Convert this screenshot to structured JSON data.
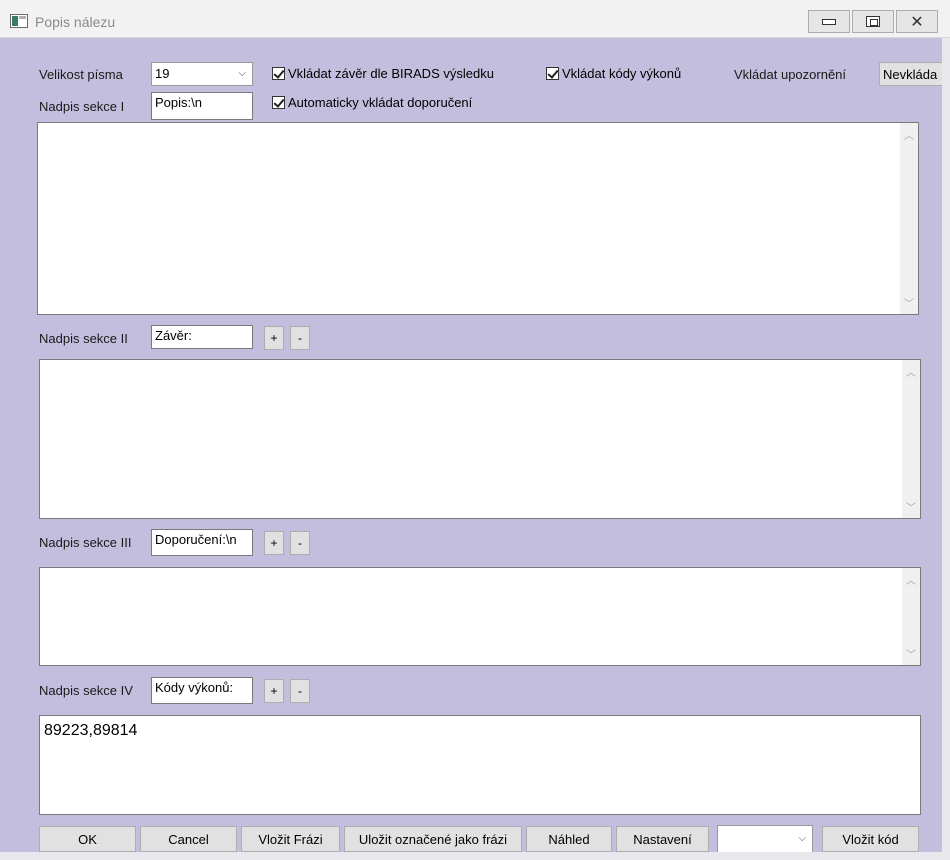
{
  "window": {
    "title": "Popis nálezu"
  },
  "toolbar": {
    "font_size_label": "Velikost písma",
    "font_size_value": "19",
    "birads_label": "Vkládat závěr dle BIRADS výsledku",
    "auto_recommend_label": "Automaticky vkládat doporučení",
    "codes_label": "Vkládat kódy výkonů",
    "warning_label": "Vkládat upozornění",
    "warning_button": "Nevkláda"
  },
  "sections": [
    {
      "label": "Nadpis sekce I",
      "title_value": "Popis:\\n",
      "content": ""
    },
    {
      "label": "Nadpis sekce II",
      "title_value": "Závěr:",
      "content": "",
      "plus": "+",
      "minus": "-"
    },
    {
      "label": "Nadpis sekce III",
      "title_value": "Doporučení:\\n",
      "content": "",
      "plus": "+",
      "minus": "-"
    },
    {
      "label": "Nadpis sekce IV",
      "title_value": "Kódy výkonů:",
      "content": "89223,89814",
      "plus": "+",
      "minus": "-"
    }
  ],
  "buttons": {
    "ok": "OK",
    "cancel": "Cancel",
    "insert_phrase": "Vložit Frázi",
    "save_phrase": "Uložit označené jako frázi",
    "preview": "Náhled",
    "settings": "Nastavení",
    "combo_value": "",
    "insert_code": "Vložit kód"
  }
}
